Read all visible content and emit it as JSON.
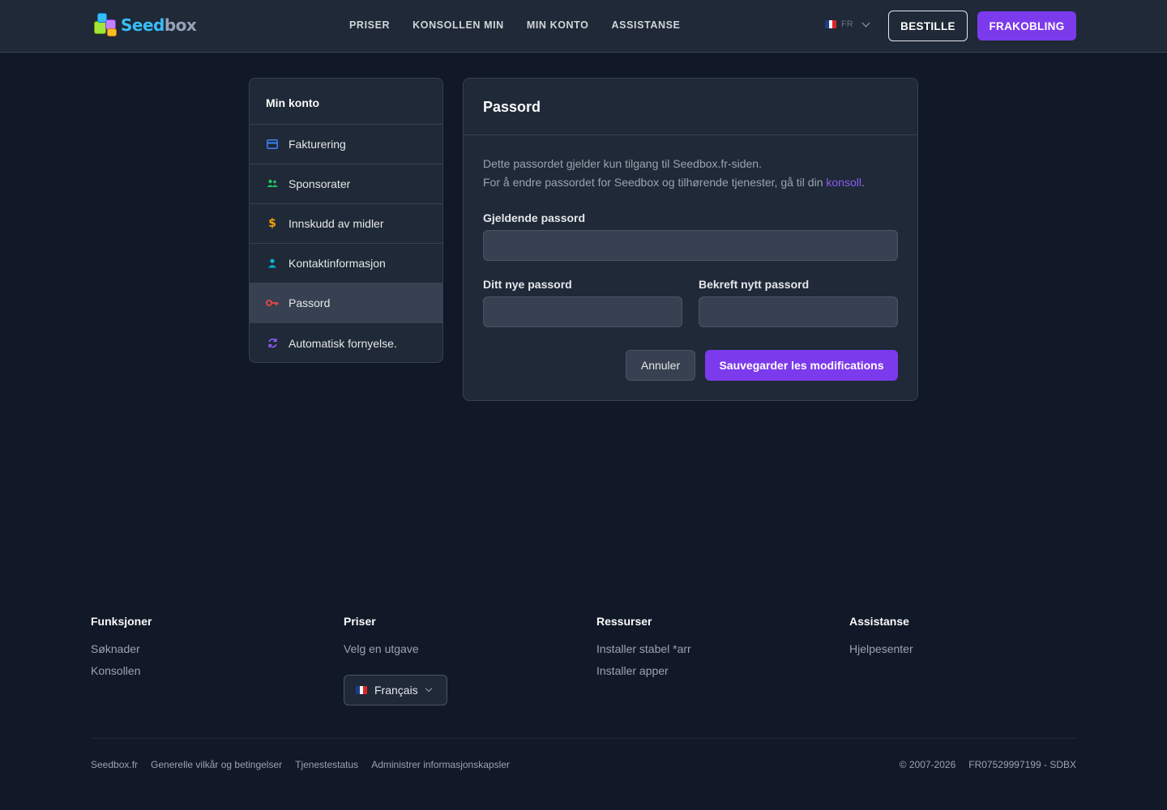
{
  "header": {
    "logo_text_a": "Seed",
    "logo_text_b": "box",
    "nav": [
      "PRISER",
      "KONSOLLEN MIN",
      "MIN KONTO",
      "ASSISTANSE"
    ],
    "lang": "FR",
    "order_label": "BESTILLE",
    "logout_label": "FRAKOBLING"
  },
  "sidebar": {
    "title": "Min konto",
    "items": [
      {
        "label": "Fakturering",
        "icon": "credit-card-icon",
        "color": "#3b82f6"
      },
      {
        "label": "Sponsorater",
        "icon": "users-icon",
        "color": "#22c55e"
      },
      {
        "label": "Innskudd av midler",
        "icon": "dollar-icon",
        "color": "#f59e0b"
      },
      {
        "label": "Kontaktinformasjon",
        "icon": "user-icon",
        "color": "#06b6d4"
      },
      {
        "label": "Passord",
        "icon": "key-icon",
        "color": "#ef4444",
        "active": true
      },
      {
        "label": "Automatisk fornyelse.",
        "icon": "refresh-icon",
        "color": "#8b5cf6"
      }
    ]
  },
  "panel": {
    "title": "Passord",
    "info_line1": "Dette passordet gjelder kun tilgang til Seedbox.fr-siden.",
    "info_line2": "For å endre passordet for Seedbox og tilhørende tjenester, gå til din",
    "info_link": "konsoll",
    "info_end": ".",
    "current_label": "Gjeldende passord",
    "new_label": "Ditt nye passord",
    "confirm_label": "Bekreft nytt passord",
    "cancel_label": "Annuler",
    "save_label": "Sauvegarder les modifications"
  },
  "footer": {
    "columns": [
      {
        "title": "Funksjoner",
        "links": [
          "Søknader",
          "Konsollen"
        ]
      },
      {
        "title": "Priser",
        "links": [
          "Velg en utgave"
        ]
      },
      {
        "title": "Ressurser",
        "links": [
          "Installer stabel *arr",
          "Installer apper"
        ]
      },
      {
        "title": "Assistanse",
        "links": [
          "Hjelpesenter"
        ]
      }
    ],
    "language": "Français",
    "bottom_links": [
      "Seedbox.fr",
      "Generelle vilkår og betingelser",
      "Tjenestestatus",
      "Administrer informasjonskapsler"
    ],
    "copyright": "© 2007-2026",
    "company_id": "FR07529997199 - SDBX"
  },
  "colors": {
    "accent": "#7c3aed",
    "background": "#111827",
    "panel": "#1f2937"
  }
}
